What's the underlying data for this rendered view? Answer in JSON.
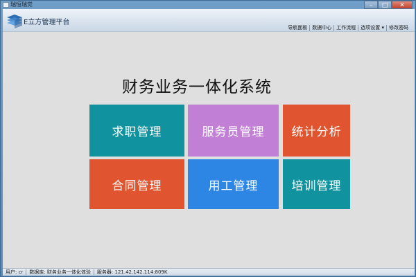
{
  "window": {
    "title": "瑞恒瑞觉",
    "controls": {
      "minimize": "–",
      "maximize": "□",
      "close": "✕"
    }
  },
  "header": {
    "app_title": "E立方管理平台",
    "logo_icon": "stack-logo-icon",
    "menu": [
      {
        "label": "导航面板"
      },
      {
        "label": "数据中心"
      },
      {
        "label": "工作流程"
      },
      {
        "label": "选项设置 ▾"
      },
      {
        "label": "修改密码"
      }
    ]
  },
  "main": {
    "system_title": "财务业务一体化系统",
    "tiles": [
      {
        "label": "求职管理",
        "color": "#11939f"
      },
      {
        "label": "服务员管理",
        "color": "#c180d6"
      },
      {
        "label": "统计分析",
        "color": "#e0552f"
      },
      {
        "label": "合同管理",
        "color": "#e0552f"
      },
      {
        "label": "用工管理",
        "color": "#2e86e4"
      },
      {
        "label": "培训管理",
        "color": "#11939f"
      }
    ]
  },
  "status": {
    "user": "用户: cr",
    "database": "数据库: 财务业务一体化体验",
    "server": "服务器: 121.42.142.114:809K"
  }
}
